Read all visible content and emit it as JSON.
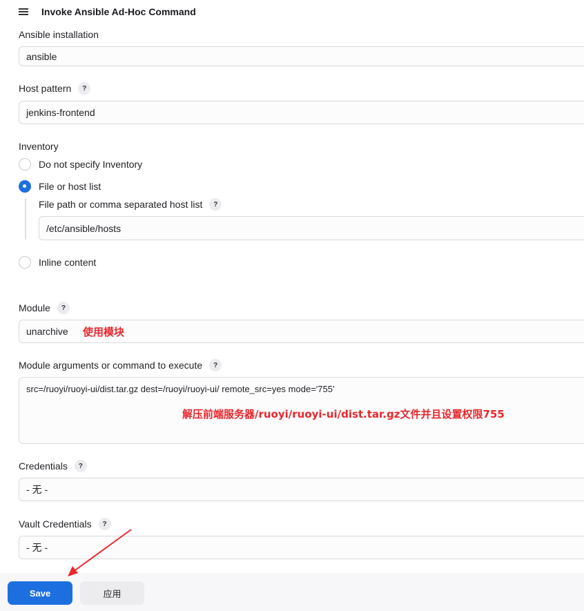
{
  "section": {
    "title": "Invoke Ansible Ad-Hoc Command"
  },
  "fields": {
    "ansible_installation": {
      "label": "Ansible installation",
      "value": "ansible"
    },
    "host_pattern": {
      "label": "Host pattern",
      "help": "?",
      "value": "jenkins-frontend"
    },
    "inventory": {
      "label": "Inventory",
      "options": [
        {
          "label": "Do not specify Inventory",
          "checked": false
        },
        {
          "label": "File or host list",
          "checked": true
        },
        {
          "label": "Inline content",
          "checked": false
        }
      ],
      "file_path": {
        "label": "File path or comma separated host list",
        "help": "?",
        "value": "/etc/ansible/hosts"
      }
    },
    "module": {
      "label": "Module",
      "help": "?",
      "value": "unarchive"
    },
    "module_args": {
      "label": "Module arguments or command to execute",
      "help": "?",
      "value": "src=/ruoyi/ruoyi-ui/dist.tar.gz dest=/ruoyi/ruoyi-ui/ remote_src=yes mode='755'"
    },
    "credentials": {
      "label": "Credentials",
      "help": "?",
      "value": "- 无 -"
    },
    "vault_credentials": {
      "label": "Vault Credentials",
      "help": "?",
      "value": "- 无 -"
    }
  },
  "annotations": {
    "module_note": "使用模块",
    "args_note": "解压前端服务器/ruoyi/ruoyi-ui/dist.tar.gz文件并且设置权限755"
  },
  "buttons": {
    "save": "Save",
    "apply": "应用"
  },
  "colors": {
    "accent": "#1d6fe0",
    "annotation": "#e8262b"
  }
}
